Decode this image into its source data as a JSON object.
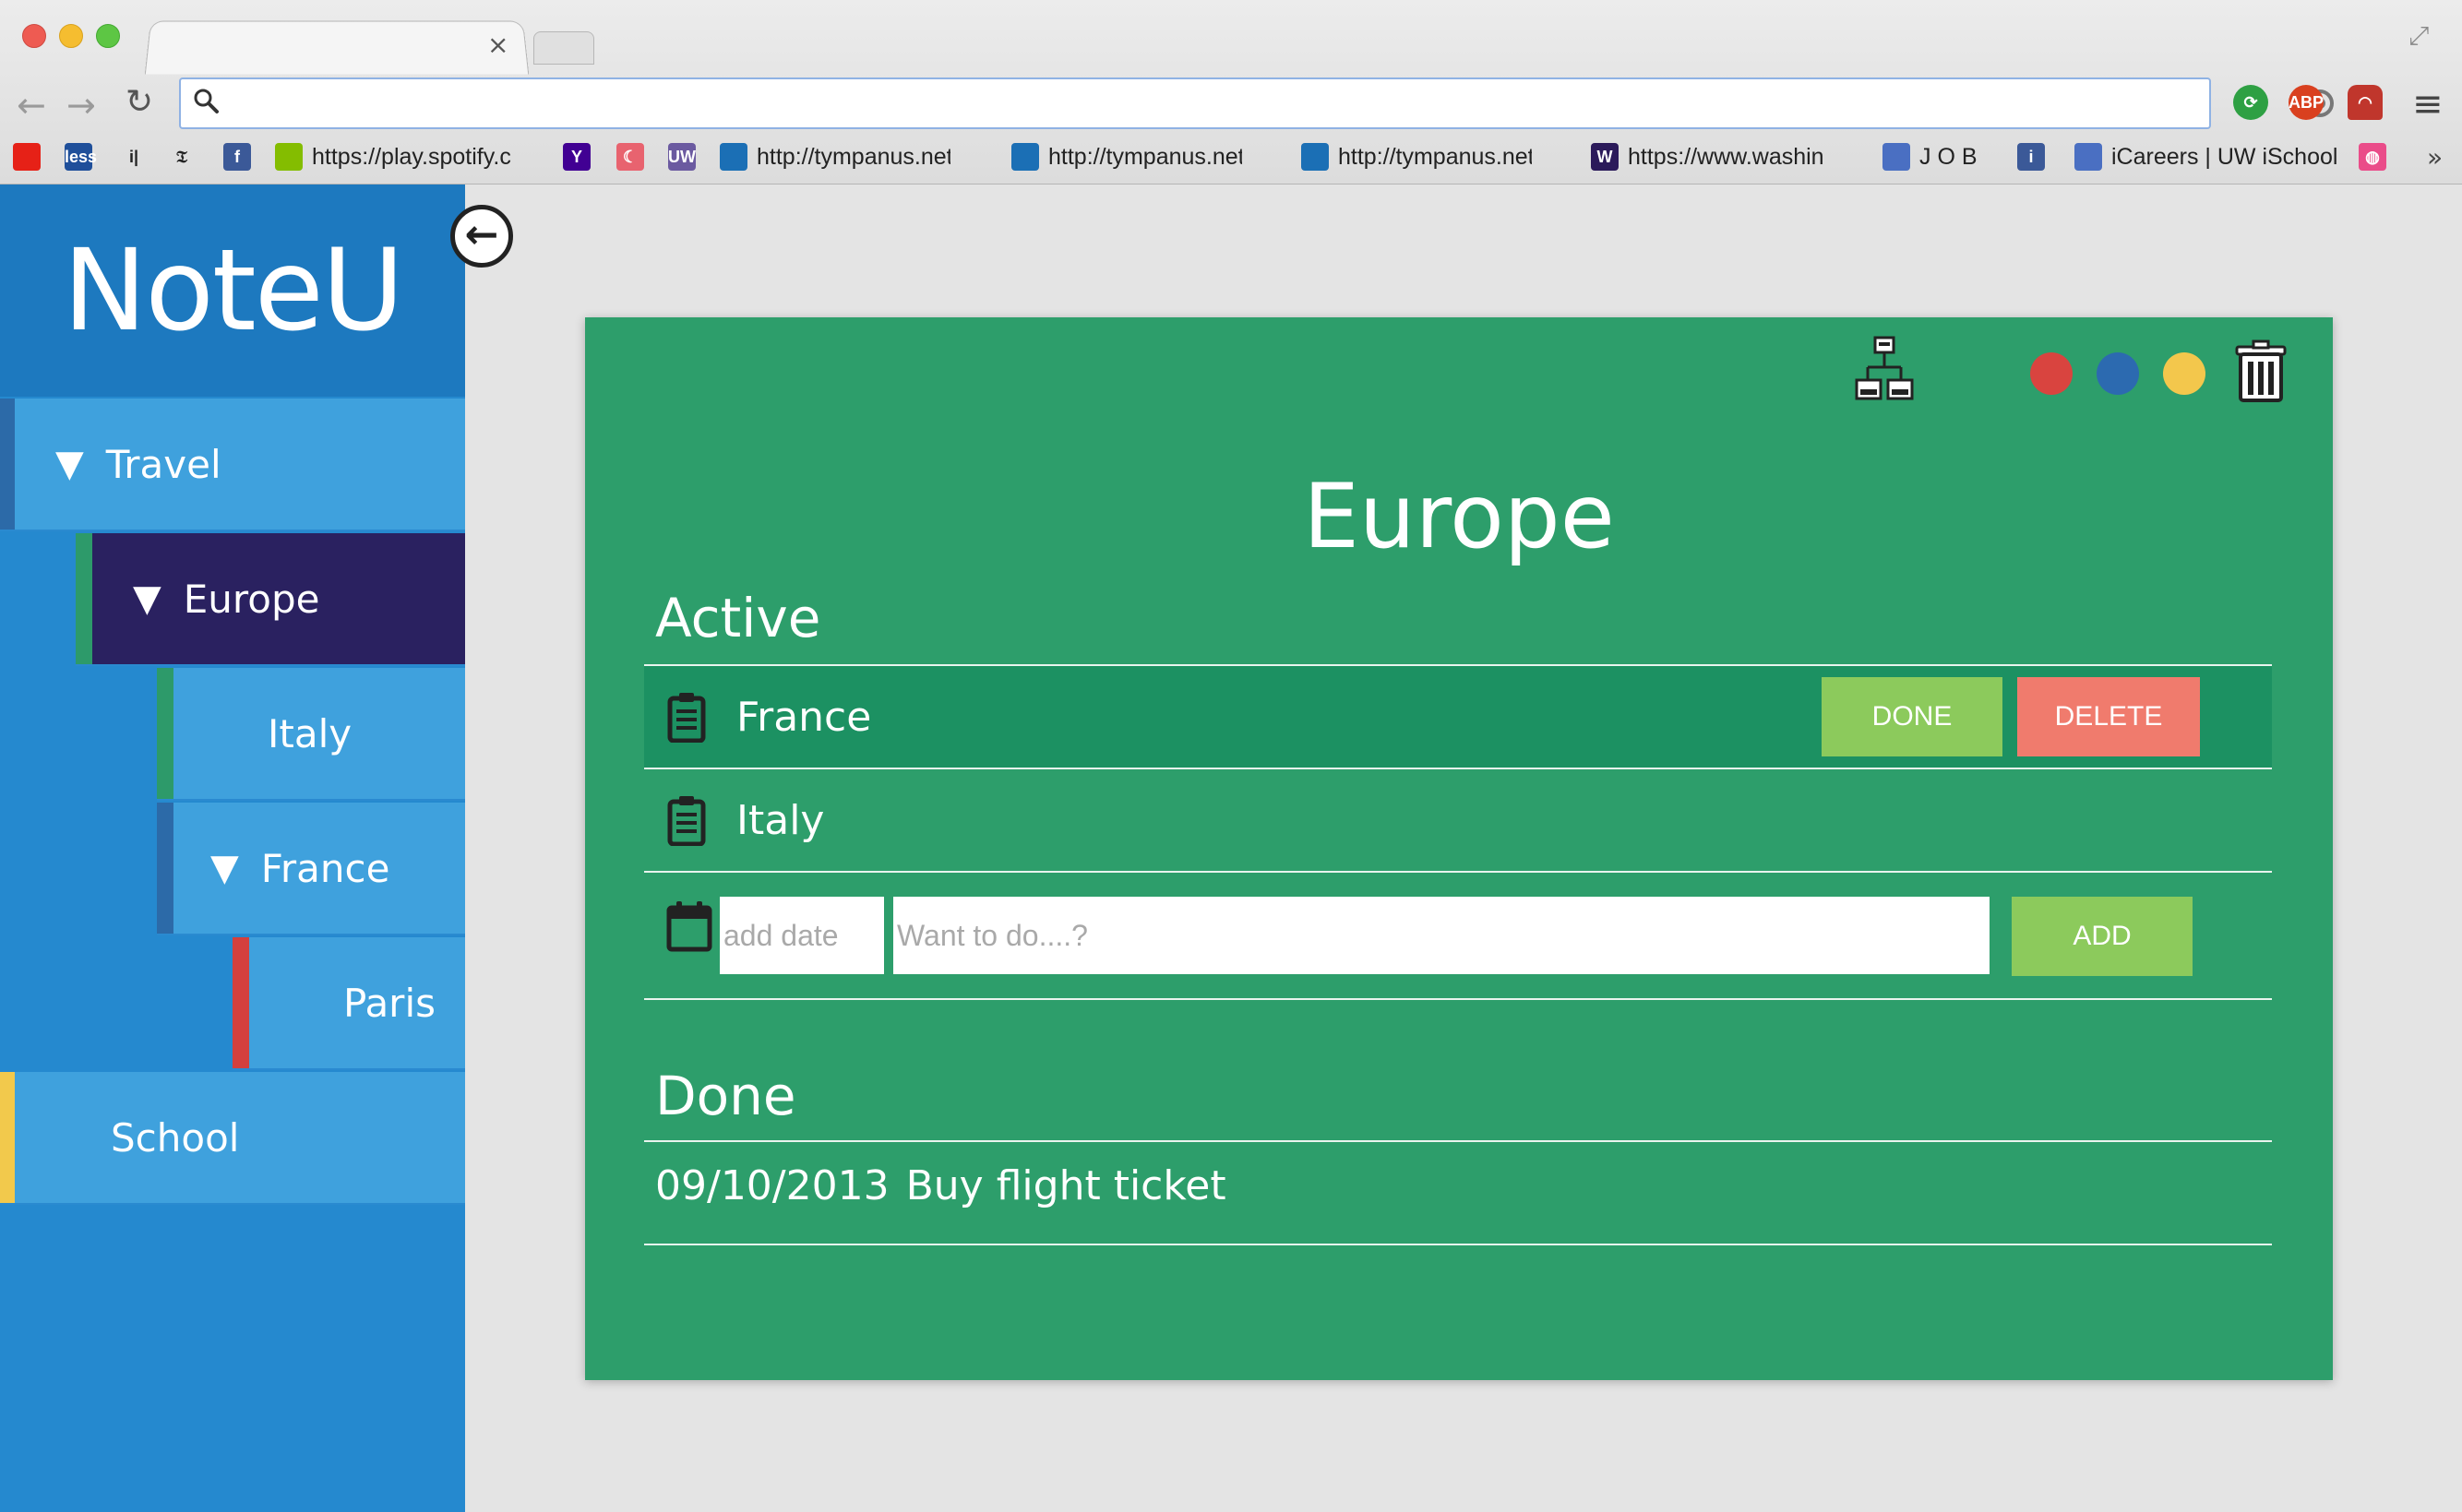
{
  "browser": {
    "tab_close": "×",
    "address_placeholder": "",
    "icons": [
      "search-icon",
      "target-icon",
      "star-icon",
      "menu-icon"
    ],
    "bookmarks": [
      {
        "text": "",
        "color": "#e62117",
        "icon": "youtube-icon"
      },
      {
        "text": "",
        "color": "#1f4f9a",
        "icon": "less-icon",
        "glyph": "less"
      },
      {
        "text": "",
        "color": "#ffffff",
        "icon": "info-icon",
        "glyph": "i|"
      },
      {
        "text": "",
        "color": "#ffffff",
        "icon": "nyt-icon",
        "glyph": "𝔗"
      },
      {
        "text": "",
        "color": "#3b5998",
        "icon": "facebook-icon",
        "glyph": "f"
      },
      {
        "text": "https://play.spotify.c",
        "color": "#84bd00",
        "icon": "spotify-icon"
      },
      {
        "text": "",
        "color": "#410093",
        "icon": "yahoo-icon",
        "glyph": "Y"
      },
      {
        "text": "",
        "color": "#e8636f",
        "icon": "moon-icon",
        "glyph": "☾"
      },
      {
        "text": "",
        "color": "#6b5aa0",
        "icon": "uw-icon",
        "glyph": "UW"
      },
      {
        "text": "http://tympanus.net",
        "color": "#1b6fb5",
        "icon": "tympanus-icon"
      },
      {
        "text": "http://tympanus.net",
        "color": "#1b6fb5",
        "icon": "tympanus-icon"
      },
      {
        "text": "http://tympanus.net",
        "color": "#1b6fb5",
        "icon": "tympanus-icon"
      },
      {
        "text": "https://www.washin",
        "color": "#2b1a5a",
        "icon": "washington-icon",
        "glyph": "W"
      },
      {
        "text": "J O B",
        "color": "#4a6fc2",
        "icon": "bookmark-page-icon"
      },
      {
        "text": "",
        "color": "#3b5998",
        "icon": "facebook-info-icon",
        "glyph": "i"
      },
      {
        "text": "iCareers | UW iSchool",
        "color": "#4a6fc2",
        "icon": "bookmark-page-icon"
      },
      {
        "text": "",
        "color": "#ea4c89",
        "icon": "dribbble-icon",
        "glyph": "◍"
      }
    ],
    "more": "»"
  },
  "app": {
    "brand": "NoteU",
    "collapse_icon": "arrow-left-circle-icon",
    "nav": {
      "travel": {
        "arrow": "▼",
        "label": "Travel"
      },
      "europe": {
        "arrow": "▼",
        "label": "Europe"
      },
      "italy": {
        "label": "Italy"
      },
      "france": {
        "arrow": "▼",
        "label": "France"
      },
      "paris": {
        "label": "Paris"
      },
      "school": {
        "label": "School"
      }
    },
    "colors": {
      "sidebar": "#2589cf",
      "selected": "#2a2160",
      "card": "#2d9e6b",
      "red": "#d9443f",
      "blue": "#2c6ab0",
      "yellow": "#f3c74c"
    }
  },
  "note": {
    "title": "Europe",
    "active_heading": "Active",
    "done_heading": "Done",
    "active_items": [
      "France",
      "Italy"
    ],
    "done_button": "DONE",
    "delete_button": "DELETE",
    "add_button": "ADD",
    "date_placeholder": "add date",
    "todo_placeholder": "Want to do....?",
    "done_items": [
      {
        "date": "09/10/2013",
        "text": "Buy flight ticket"
      }
    ]
  }
}
